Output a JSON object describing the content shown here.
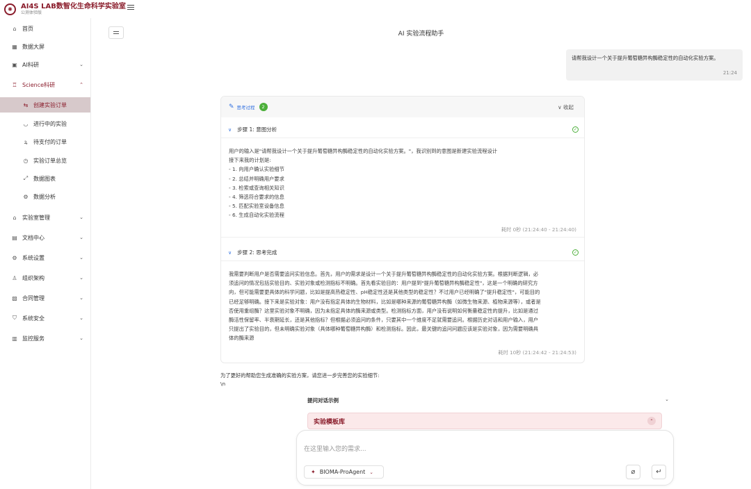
{
  "header": {
    "logo_glyph": "✺",
    "title": "AI4S LAB数智化生命科学实验室",
    "subtitle": "公测体验版"
  },
  "sidebar": {
    "items": [
      {
        "label": "首页",
        "icon": "home-icon"
      },
      {
        "label": "数据大屏",
        "icon": "dashboard-icon"
      },
      {
        "label": "AI科研",
        "icon": "monitor-icon"
      },
      {
        "label": "Science科研",
        "icon": "flask-icon"
      },
      {
        "label": "创建实验订单",
        "icon": "create-order-icon"
      },
      {
        "label": "进行中的实验",
        "icon": "loading-icon"
      },
      {
        "label": "待支付的订单",
        "icon": "payment-icon"
      },
      {
        "label": "实验订单总览",
        "icon": "overview-icon"
      },
      {
        "label": "数据图表",
        "icon": "chart-icon"
      },
      {
        "label": "数据分析",
        "icon": "analysis-icon"
      },
      {
        "label": "实验室管理",
        "icon": "lab-icon"
      },
      {
        "label": "文档中心",
        "icon": "document-icon"
      },
      {
        "label": "系统设置",
        "icon": "settings-icon"
      },
      {
        "label": "组织架构",
        "icon": "org-icon"
      },
      {
        "label": "合同管理",
        "icon": "contract-icon"
      },
      {
        "label": "系统安全",
        "icon": "security-icon"
      },
      {
        "label": "监控服务",
        "icon": "monitor-chart-icon"
      }
    ]
  },
  "main": {
    "title": "AI 实验流程助手",
    "user_message": {
      "text": "请帮我设计一个关于提升葡萄糖异构酶稳定性的自动化实验方案。",
      "time": "21:24"
    },
    "thinking": {
      "label": "思考过程",
      "count": "2",
      "fold_label": "∨ 收起",
      "steps": [
        {
          "title": "步骤 1: 意图分析",
          "lines": [
            "用户的输入是\"请帮我设计一个关于提升葡萄糖异构酶稳定性的自动化实验方案。\"，我识别到的意图是新建实验流程设计",
            "接下来我的计划是:",
            "- 1. 向用户确认实验细节",
            "- 2. 总结并明确用户要求",
            "- 3. 检索或查询相关知识",
            "- 4. 筛选符合要求的信息",
            "- 5. 匹配实验室设备信息",
            "- 6. 生成自动化实验流程"
          ],
          "meta": "耗时 0秒 (21:24:40 - 21:24:40)"
        },
        {
          "title": "步骤 2: 思考完成",
          "lines": [
            "我需要判断用户是否需要追问实验信息。首先，用户的需求是设计一个关于提升葡萄糖异构酶稳定性的自动化实验方案。根据判断逻辑，必",
            "须追问的情况包括实验目的、实验对象或检测指标不明确。首先看实验目的：用户提到\"提升葡萄糖异构酶稳定性\"，这是一个明确的研究方",
            "向，但可能需要更具体的科学问题，比如是提高热稳定性、pH稳定性还是其他类型的稳定性？不过用户已经明确了\"提升稳定性\"，可能目的",
            "已经足够明确。接下来是实验对象：用户没有指定具体的生物材料，比如是哪种来源的葡萄糖异构酶（如微生物来源、植物来源等），或者是",
            "否使用重组酶？这里实验对象不明确，因为未指定具体的酶来源或类型。检测指标方面，用户没有说明如何衡量稳定性的提升，比如是通过",
            "酶活性保留率、半衰期延长，还是其他指标？但根据必须追问的条件，只要其中一个维度不足就需要追问。根据历史对话和用户输入，用户",
            "只提出了实验目的，但未明确实验对象（具体哪种葡萄糖异构酶）和检测指标。因此，最关键的追问问题应该是实验对象，因为需要明确具",
            "体的酶来源"
          ],
          "meta": "耗时 10秒 (21:24:42 - 21:24:53)"
        }
      ]
    },
    "reply_lines": [
      "为了更好的帮助您生成准确的实验方案，请您进一步完善您的实验细节:",
      "\\n"
    ],
    "examples_title": "提问对话示例",
    "template_title": "实验模板库",
    "composer": {
      "placeholder": "在这里输入您的需求...",
      "agent": "BIOMA-ProAgent"
    }
  },
  "colors": {
    "brand": "#8a1c2b",
    "link": "#2f6fe0",
    "success": "#4caf3a",
    "selected_bg": "#d7c9cb"
  }
}
